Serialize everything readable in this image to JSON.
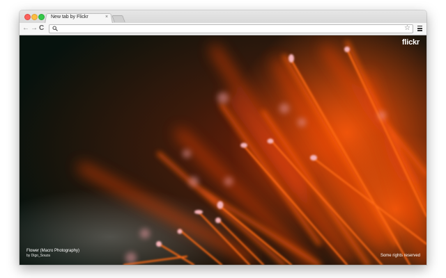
{
  "tab": {
    "title": "New tab by Flickr",
    "close_glyph": "×"
  },
  "toolbar": {
    "back_glyph": "←",
    "forward_glyph": "→",
    "reload_glyph": "C",
    "omnibox_value": "",
    "star_glyph": "☆"
  },
  "content": {
    "brand": "flickr",
    "photo_title": "Flower (Macro Photography)",
    "photo_author": "by Digo_Souza",
    "rights": "Some rights reserved"
  },
  "icons": {
    "close": "close-icon",
    "back": "back-arrow-icon",
    "forward": "forward-arrow-icon",
    "reload": "reload-icon",
    "search": "search-icon",
    "star": "star-icon",
    "menu": "hamburger-menu-icon"
  },
  "colors": {
    "close_red": "#fc605b",
    "minimize_yellow": "#fdbc40",
    "zoom_green": "#34c84a",
    "photo_orange": "#ff5a0a"
  }
}
